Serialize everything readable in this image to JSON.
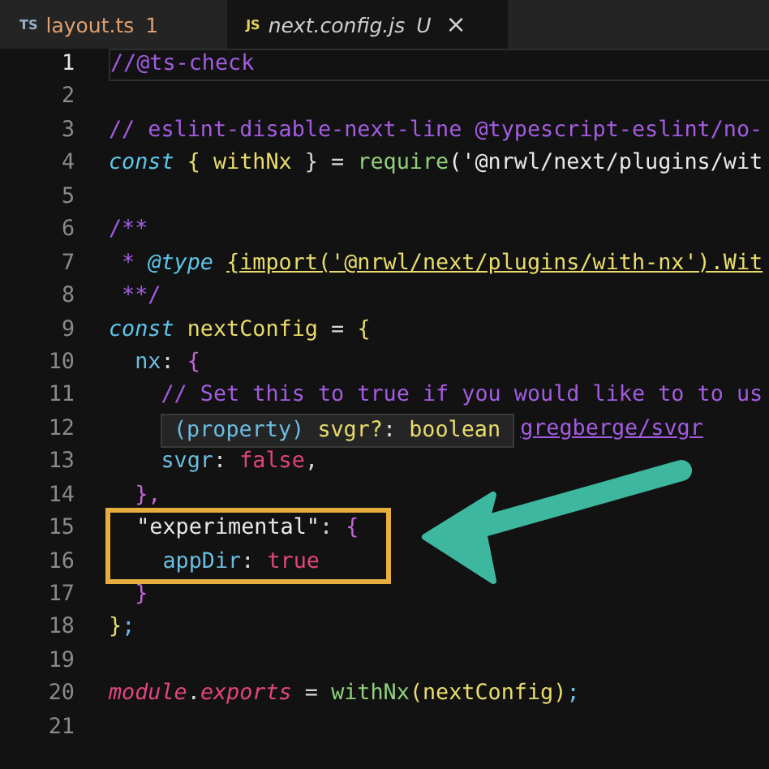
{
  "tabs": [
    {
      "badge": "TS",
      "color": "#9ab1c9",
      "label": "layout.ts",
      "count": "1",
      "selected": false,
      "preview": false
    },
    {
      "badge": "JS",
      "color": "#e3cf5b",
      "label": "next.config.js",
      "status": "U",
      "close": "×",
      "selected": true,
      "preview": true
    }
  ],
  "editor": {
    "lines": [
      {
        "number": "1",
        "current": true,
        "tokens": [
          {
            "text": "//@ts-check",
            "kind": "comment"
          }
        ]
      },
      {
        "number": "2",
        "current": false
      },
      {
        "number": "3",
        "current": false,
        "tokens": [
          {
            "text": "// eslint-disable-next-line @typescript-eslint/no-",
            "kind": "comment"
          }
        ]
      },
      {
        "number": "4",
        "current": false,
        "tokens": [
          {
            "text": "const",
            "kind": "keyword"
          },
          {
            "text": " { ",
            "kind": "brace"
          },
          {
            "text": "withNx",
            "kind": "variable"
          },
          {
            "text": " } = ",
            "kind": "plain"
          },
          {
            "text": "require",
            "kind": "func"
          },
          {
            "text": "('@nrwl/next/plugins/wit",
            "kind": "string"
          }
        ]
      },
      {
        "number": "5",
        "current": false
      },
      {
        "number": "6",
        "current": false,
        "tokens": [
          {
            "text": "/**",
            "kind": "comment"
          }
        ]
      },
      {
        "number": "7",
        "current": false,
        "tokens": [
          {
            "text": " * ",
            "kind": "comment"
          },
          {
            "text": "@type ",
            "kind": "doctag"
          },
          {
            "text": "{import('@nrwl/next/plugins/with-nx').Wit",
            "kind": "type"
          }
        ]
      },
      {
        "number": "8",
        "current": false,
        "tokens": [
          {
            "text": " **/",
            "kind": "comment"
          }
        ]
      },
      {
        "number": "9",
        "current": false,
        "tokens": [
          {
            "text": "const",
            "kind": "keyword"
          },
          {
            "text": " nextConfig",
            "kind": "variable"
          },
          {
            "text": " = ",
            "kind": "plain"
          },
          {
            "text": "{",
            "kind": "brace"
          }
        ]
      },
      {
        "number": "10",
        "current": false,
        "tokens": [
          {
            "text": "  nx",
            "kind": "property"
          },
          {
            "text": ": ",
            "kind": "plain"
          },
          {
            "text": "{",
            "kind": "brace2"
          }
        ]
      },
      {
        "number": "11",
        "current": false,
        "tokens": [
          {
            "text": "    // Set this to true if you would like to to us",
            "kind": "comment"
          }
        ]
      },
      {
        "number": "12",
        "current": false,
        "tooltip": [
          {
            "text": "(property) ",
            "kind": "property"
          },
          {
            "text": "svgr?",
            "kind": "variable"
          },
          {
            "text": ": ",
            "kind": "plain"
          },
          {
            "text": "boolean",
            "kind": "variable"
          }
        ],
        "tokens": [
          {
            "text": "gregberge/svgr",
            "kind": "link"
          }
        ]
      },
      {
        "number": "13",
        "current": false,
        "tokens": [
          {
            "text": "    svgr",
            "kind": "property"
          },
          {
            "text": ": ",
            "kind": "plain"
          },
          {
            "text": "false",
            "kind": "boolean"
          },
          {
            "text": ",",
            "kind": "plain"
          }
        ]
      },
      {
        "number": "14",
        "current": false,
        "tokens": [
          {
            "text": "  },",
            "kind": "brace2"
          }
        ]
      },
      {
        "number": "15",
        "current": false,
        "highlighted": true,
        "tokens": [
          {
            "text": "  \"experimental\"",
            "kind": "string"
          },
          {
            "text": ": ",
            "kind": "plain"
          },
          {
            "text": "{",
            "kind": "brace2"
          }
        ]
      },
      {
        "number": "16",
        "current": false,
        "highlighted": true,
        "tokens": [
          {
            "text": "    appDir",
            "kind": "property"
          },
          {
            "text": ": ",
            "kind": "plain"
          },
          {
            "text": "true",
            "kind": "boolean"
          }
        ]
      },
      {
        "number": "17",
        "current": false,
        "tokens": [
          {
            "text": "  }",
            "kind": "brace2"
          }
        ]
      },
      {
        "number": "18",
        "current": false,
        "tokens": [
          {
            "text": "}",
            "kind": "brace"
          },
          {
            "text": ";",
            "kind": "property"
          }
        ]
      },
      {
        "number": "19",
        "current": false
      },
      {
        "number": "20",
        "current": false,
        "tokens": [
          {
            "text": "module",
            "kind": "object"
          },
          {
            "text": ".",
            "kind": "plain"
          },
          {
            "text": "exports",
            "kind": "object"
          },
          {
            "text": " = ",
            "kind": "plain"
          },
          {
            "text": "withNx",
            "kind": "func"
          },
          {
            "text": "(",
            "kind": "brace"
          },
          {
            "text": "nextConfig",
            "kind": "variable"
          },
          {
            "text": ")",
            "kind": "brace"
          },
          {
            "text": ";",
            "kind": "property"
          }
        ]
      },
      {
        "number": "21",
        "current": false
      }
    ]
  }
}
